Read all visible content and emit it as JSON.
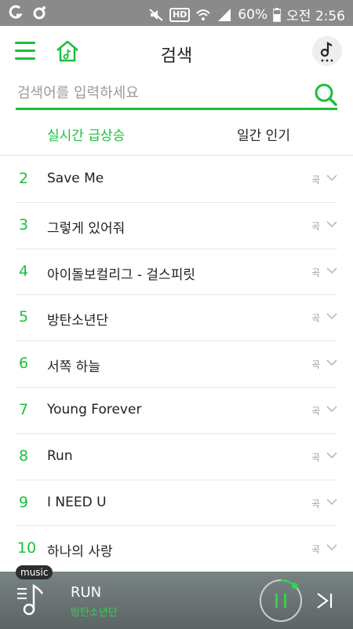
{
  "status_bar": {
    "battery": "60%",
    "time": "오전 2:56",
    "hd_label": "HD",
    "icons": [
      "carrier-g-icon",
      "ring-icon",
      "mute-icon",
      "hd-icon",
      "wifi-icon",
      "signal-icon",
      "battery-icon"
    ]
  },
  "header": {
    "title": "검색",
    "menu_icon": "hamburger-icon",
    "home_icon": "home-music-icon",
    "profile_icon": "music-note-profile-icon"
  },
  "search": {
    "placeholder": "검색어를 입력하세요",
    "value": "",
    "button_icon": "search-icon"
  },
  "tabs": [
    {
      "label": "실시간 급상승",
      "active": true
    },
    {
      "label": "일간 인기",
      "active": false
    }
  ],
  "keywords": [
    {
      "rank": "2",
      "keyword": "Save Me",
      "type": "곡"
    },
    {
      "rank": "3",
      "keyword": "그렇게 있어줘",
      "type": "곡"
    },
    {
      "rank": "4",
      "keyword": "아이돌보컬리그 - 걸스피릿",
      "type": "곡"
    },
    {
      "rank": "5",
      "keyword": "방탄소년단",
      "type": "곡"
    },
    {
      "rank": "6",
      "keyword": "서쪽 하늘",
      "type": "곡"
    },
    {
      "rank": "7",
      "keyword": "Young Forever",
      "type": "곡"
    },
    {
      "rank": "8",
      "keyword": "Run",
      "type": "곡"
    },
    {
      "rank": "9",
      "keyword": "I NEED U",
      "type": "곡"
    },
    {
      "rank": "10",
      "keyword": "하나의 사랑",
      "type": "곡"
    }
  ],
  "player": {
    "badge": "music",
    "title": "RUN",
    "artist": "방탄소년단",
    "progress": 0.12
  },
  "colors": {
    "accent": "#1dbf3c",
    "text": "#222222",
    "status_bar": "#8a8a8a"
  }
}
